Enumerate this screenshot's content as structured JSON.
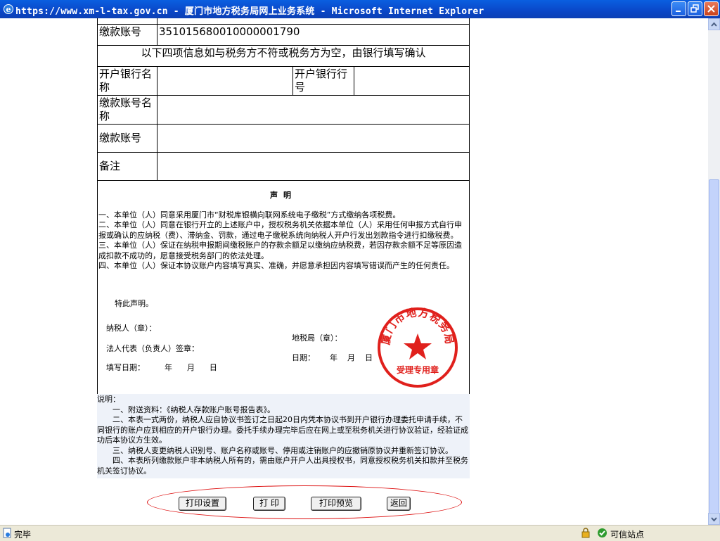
{
  "window": {
    "title": "https://www.xm-l-tax.gov.cn - 厦门市地方税务局网上业务系统 - Microsoft Internet Explorer"
  },
  "form": {
    "account_no_label": "缴款账号",
    "account_no_value": "351015680010000001790",
    "bank_confirm_note": "以下四项信息如与税务方不符或税务方为空，由银行填写确认",
    "bank_name_label": "开户银行名称",
    "bank_code_label": "开户银行行号",
    "account_name_label": "缴款账号名称",
    "account_no2_label": "缴款账号",
    "remark_label": "备注"
  },
  "declaration": {
    "title": "声明",
    "items": [
      "一、本单位（人）同意采用厦门市“财税库银横向联网系统电子缴税”方式缴纳各项税费。",
      "二、本单位（人）同意在银行开立的上述账户中，授权税务机关依据本单位（人）采用任何申报方式自行申报或确认的应纳税（费）、滞纳金、罚款，通过电子缴税系统向纳税人开户行发出划款指令进行扣缴税费。",
      "三、本单位（人）保证在纳税申报期间缴税账户的存款余额足以缴纳应纳税费，若因存款余额不足等原因造成扣款不成功的，愿意接受税务部门的依法处理。",
      "四、本单位（人）保证本协议账户内容填写真实、准确，并愿意承担因内容填写错误而产生的任何责任。"
    ],
    "hereby": "特此声明。",
    "taxpayer_seal": "纳税人（章）：",
    "legal_rep_sign": "法人代表（负责人）签章：",
    "fill_date": "填写日期：        年      月      日",
    "tax_bureau_seal": "地税局（章）：",
    "bureau_date": "日期：      年    月    日",
    "seal_text_top": "厦门市地方税务局",
    "seal_text_bottom": "受理专用章"
  },
  "explanation": {
    "heading": "说明：",
    "items": [
      "一、附送资料：《纳税人存款账户账号报告表》。",
      "二、本表一式两份，纳税人应自协议书签订之日起20日内凭本协议书到开户银行办理委托申请手续，不同银行的账户应到相应的开户银行办理。委托手续办理完毕后应在网上或至税务机关进行协议验证，经验证成功后本协议方生效。",
      "三、纳税人变更纳税人识别号、账户名称或账号、停用或注销账户的应撤销原协议并重新签订协议。",
      "四、本表所列缴款账户非本纳税人所有的，需由账户开户人出具授权书，同意授权税务机关扣款并至税务机关签订协议。"
    ]
  },
  "buttons": {
    "print_setup": "打印设置",
    "print": "打 印",
    "print_preview": "打印预览",
    "back": "返回"
  },
  "statusbar": {
    "done": "完毕",
    "zone": "可信站点"
  },
  "colors": {
    "titlebar": "#0a47c8",
    "seal_red": "#e0201c",
    "oval_red": "#dd1111"
  }
}
